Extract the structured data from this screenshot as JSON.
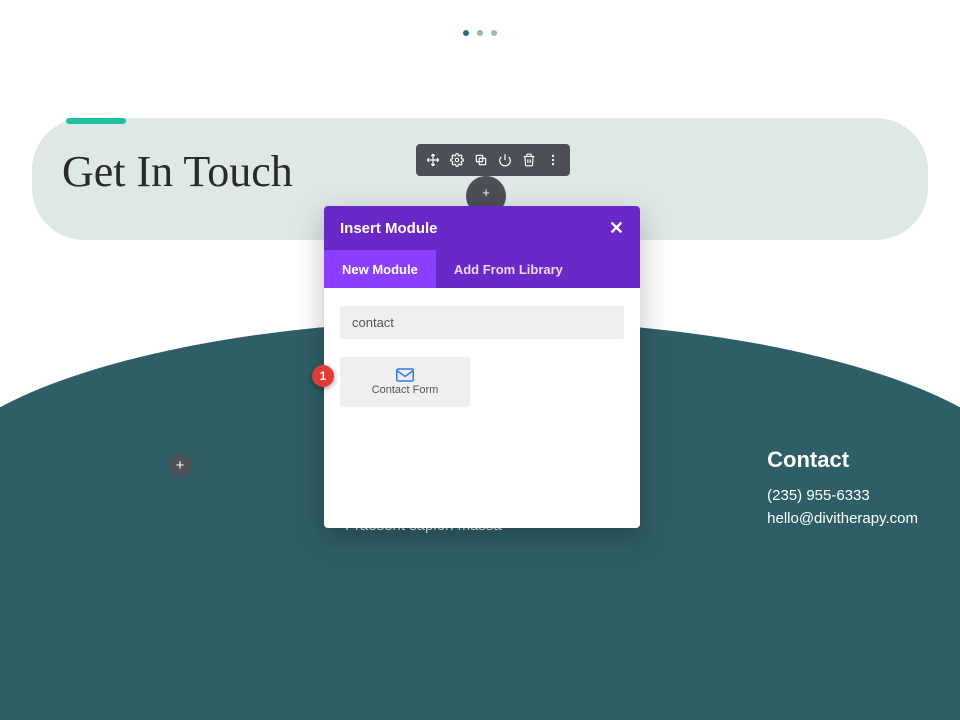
{
  "pager": {
    "count": 3,
    "active": 0
  },
  "hero": {
    "title": "Get In Touch"
  },
  "toolbar": {
    "icons": [
      "move-icon",
      "gear-icon",
      "duplicate-icon",
      "power-icon",
      "trash-icon",
      "more-icon"
    ]
  },
  "modal": {
    "title": "Insert Module",
    "tabs": {
      "new": "New Module",
      "library": "Add From Library"
    },
    "search_value": "contact",
    "search_placeholder": "",
    "result": {
      "label": "Contact Form",
      "icon": "mail-icon"
    }
  },
  "annotation": {
    "badge": "1"
  },
  "footer": {
    "body_fragment": "Praesent sapien massa",
    "contact_heading": "Contact",
    "phone": "(235) 955-6333",
    "email": "hello@divitherapy.com"
  }
}
